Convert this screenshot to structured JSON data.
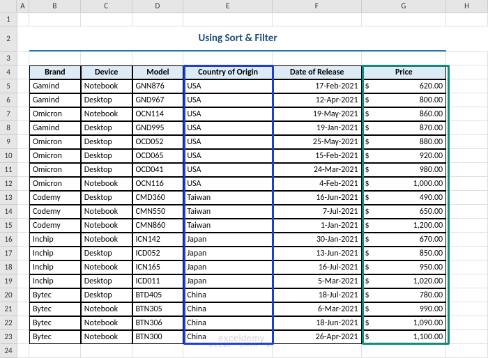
{
  "columns": [
    "A",
    "B",
    "C",
    "D",
    "E",
    "F",
    "G",
    "H"
  ],
  "title": "Using Sort & Filter",
  "headers": {
    "brand": "Brand",
    "device": "Device",
    "model": "Model",
    "country": "Country of Origin",
    "date": "Date of Release",
    "price": "Price"
  },
  "currency": "$",
  "rows": [
    {
      "brand": "Gamind",
      "device": "Notebook",
      "model": "GNN876",
      "country": "USA",
      "date": "17-Feb-2021",
      "price": "620.00"
    },
    {
      "brand": "Gamind",
      "device": "Desktop",
      "model": "GND967",
      "country": "USA",
      "date": "12-Apr-2021",
      "price": "800.00"
    },
    {
      "brand": "Omicron",
      "device": "Notebook",
      "model": "OCN114",
      "country": "USA",
      "date": "19-May-2021",
      "price": "860.00"
    },
    {
      "brand": "Gamind",
      "device": "Desktop",
      "model": "GND995",
      "country": "USA",
      "date": "19-Jan-2021",
      "price": "870.00"
    },
    {
      "brand": "Omicron",
      "device": "Desktop",
      "model": "OCD052",
      "country": "USA",
      "date": "25-May-2021",
      "price": "880.00"
    },
    {
      "brand": "Omicron",
      "device": "Desktop",
      "model": "OCD065",
      "country": "USA",
      "date": "15-Feb-2021",
      "price": "920.00"
    },
    {
      "brand": "Omicron",
      "device": "Desktop",
      "model": "OCD041",
      "country": "USA",
      "date": "24-Mar-2021",
      "price": "980.00"
    },
    {
      "brand": "Omicron",
      "device": "Notebook",
      "model": "OCN116",
      "country": "USA",
      "date": "4-Feb-2021",
      "price": "1,000.00"
    },
    {
      "brand": "Codemy",
      "device": "Desktop",
      "model": "CMD360",
      "country": "Taiwan",
      "date": "16-Jun-2021",
      "price": "490.00"
    },
    {
      "brand": "Codemy",
      "device": "Notebook",
      "model": "CMN550",
      "country": "Taiwan",
      "date": "7-Jul-2021",
      "price": "650.00"
    },
    {
      "brand": "Codemy",
      "device": "Notebook",
      "model": "CMN860",
      "country": "Taiwan",
      "date": "1-Jan-2021",
      "price": "1,200.00"
    },
    {
      "brand": "Inchip",
      "device": "Notebook",
      "model": "ICN142",
      "country": "Japan",
      "date": "30-Jan-2021",
      "price": "670.00"
    },
    {
      "brand": "Inchip",
      "device": "Desktop",
      "model": "ICD052",
      "country": "Japan",
      "date": "13-Jun-2021",
      "price": "850.00"
    },
    {
      "brand": "Inchip",
      "device": "Notebook",
      "model": "ICN165",
      "country": "Japan",
      "date": "16-Jul-2021",
      "price": "950.00"
    },
    {
      "brand": "Inchip",
      "device": "Desktop",
      "model": "ICD011",
      "country": "Japan",
      "date": "5-Mar-2021",
      "price": "1,020.00"
    },
    {
      "brand": "Bytec",
      "device": "Desktop",
      "model": "BTD405",
      "country": "China",
      "date": "18-Jul-2021",
      "price": "780.00"
    },
    {
      "brand": "Bytec",
      "device": "Notebook",
      "model": "BTN305",
      "country": "China",
      "date": "6-Mar-2021",
      "price": "990.00"
    },
    {
      "brand": "Bytec",
      "device": "Notebook",
      "model": "BTN306",
      "country": "China",
      "date": "18-Jun-2021",
      "price": "1,090.00"
    },
    {
      "brand": "Bytec",
      "device": "Notebook",
      "model": "BTN300",
      "country": "China",
      "date": "26-Apr-2021",
      "price": "1,100.00"
    }
  ],
  "watermark": {
    "main": "exceldemy",
    "sub": "EXCEL · DATA · BI"
  }
}
